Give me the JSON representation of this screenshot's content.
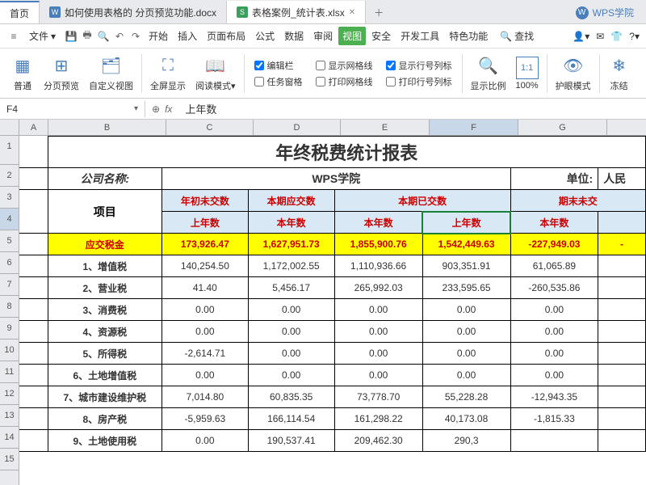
{
  "tabs": {
    "home": "首页",
    "doc": "如何使用表格的 分页预览功能.docx",
    "xlsx": "表格案例_统计表.xlsx",
    "wps": "WPS学院"
  },
  "menu": {
    "file": "文件",
    "items": [
      "开始",
      "插入",
      "页面布局",
      "公式",
      "数据",
      "审阅",
      "视图",
      "安全",
      "开发工具",
      "特色功能"
    ],
    "search": "查找"
  },
  "toolbar": {
    "normal": "普通",
    "pagebreak": "分页预览",
    "custom": "自定义视图",
    "fullscreen": "全屏显示",
    "readmode": "阅读模式",
    "formulabar": "编辑栏",
    "taskpane": "任务窗格",
    "showgrid": "显示网格线",
    "printgrid": "打印网格线",
    "showrowcol": "显示行号列标",
    "printrowcol": "打印行号列标",
    "zoom": "显示比例",
    "zoom100": "100%",
    "eyecare": "护眼模式",
    "freeze": "冻结"
  },
  "cellref": "F4",
  "formula": "上年数",
  "cols": [
    "A",
    "B",
    "C",
    "D",
    "E",
    "F",
    "G"
  ],
  "sheet": {
    "title": "年终税费统计报表",
    "company_label": "公司名称:",
    "company": "WPS学院",
    "unit_label": "单位:",
    "unit": "人民",
    "project": "项目",
    "h_c": "年初未交数",
    "h_d": "本期应交数",
    "h_ef": "本期已交数",
    "h_gh": "期末未交",
    "s_c": "上年数",
    "s_d": "本年数",
    "s_e": "本年数",
    "s_f": "上年数",
    "s_g": "本年数",
    "rows": [
      {
        "label": "应交税金",
        "c": "173,926.47",
        "d": "1,627,951.73",
        "e": "1,855,900.76",
        "f": "1,542,449.63",
        "g": "-227,949.03",
        "h": "-",
        "yellow": true
      },
      {
        "label": "1、增值税",
        "c": "140,254.50",
        "d": "1,172,002.55",
        "e": "1,110,936.66",
        "f": "903,351.91",
        "g": "61,065.89"
      },
      {
        "label": "2、营业税",
        "c": "41.40",
        "d": "5,456.17",
        "e": "265,992.03",
        "f": "233,595.65",
        "g": "-260,535.86"
      },
      {
        "label": "3、消费税",
        "c": "0.00",
        "d": "0.00",
        "e": "0.00",
        "f": "0.00",
        "g": "0.00"
      },
      {
        "label": "4、资源税",
        "c": "0.00",
        "d": "0.00",
        "e": "0.00",
        "f": "0.00",
        "g": "0.00"
      },
      {
        "label": "5、所得税",
        "c": "-2,614.71",
        "d": "0.00",
        "e": "0.00",
        "f": "0.00",
        "g": "0.00"
      },
      {
        "label": "6、土地增值税",
        "c": "0.00",
        "d": "0.00",
        "e": "0.00",
        "f": "0.00",
        "g": "0.00"
      },
      {
        "label": "7、城市建设维护税",
        "c": "7,014.80",
        "d": "60,835.35",
        "e": "73,778.70",
        "f": "55,228.28",
        "g": "-12,943.35"
      },
      {
        "label": "8、房产税",
        "c": "-5,959.63",
        "d": "166,114.54",
        "e": "161,298.22",
        "f": "40,173.08",
        "g": "-1,815.33"
      },
      {
        "label": "9、土地使用税",
        "c": "0.00",
        "d": "190,537.41",
        "e": "209,462.30",
        "f": "290,3",
        "g": ""
      }
    ]
  }
}
